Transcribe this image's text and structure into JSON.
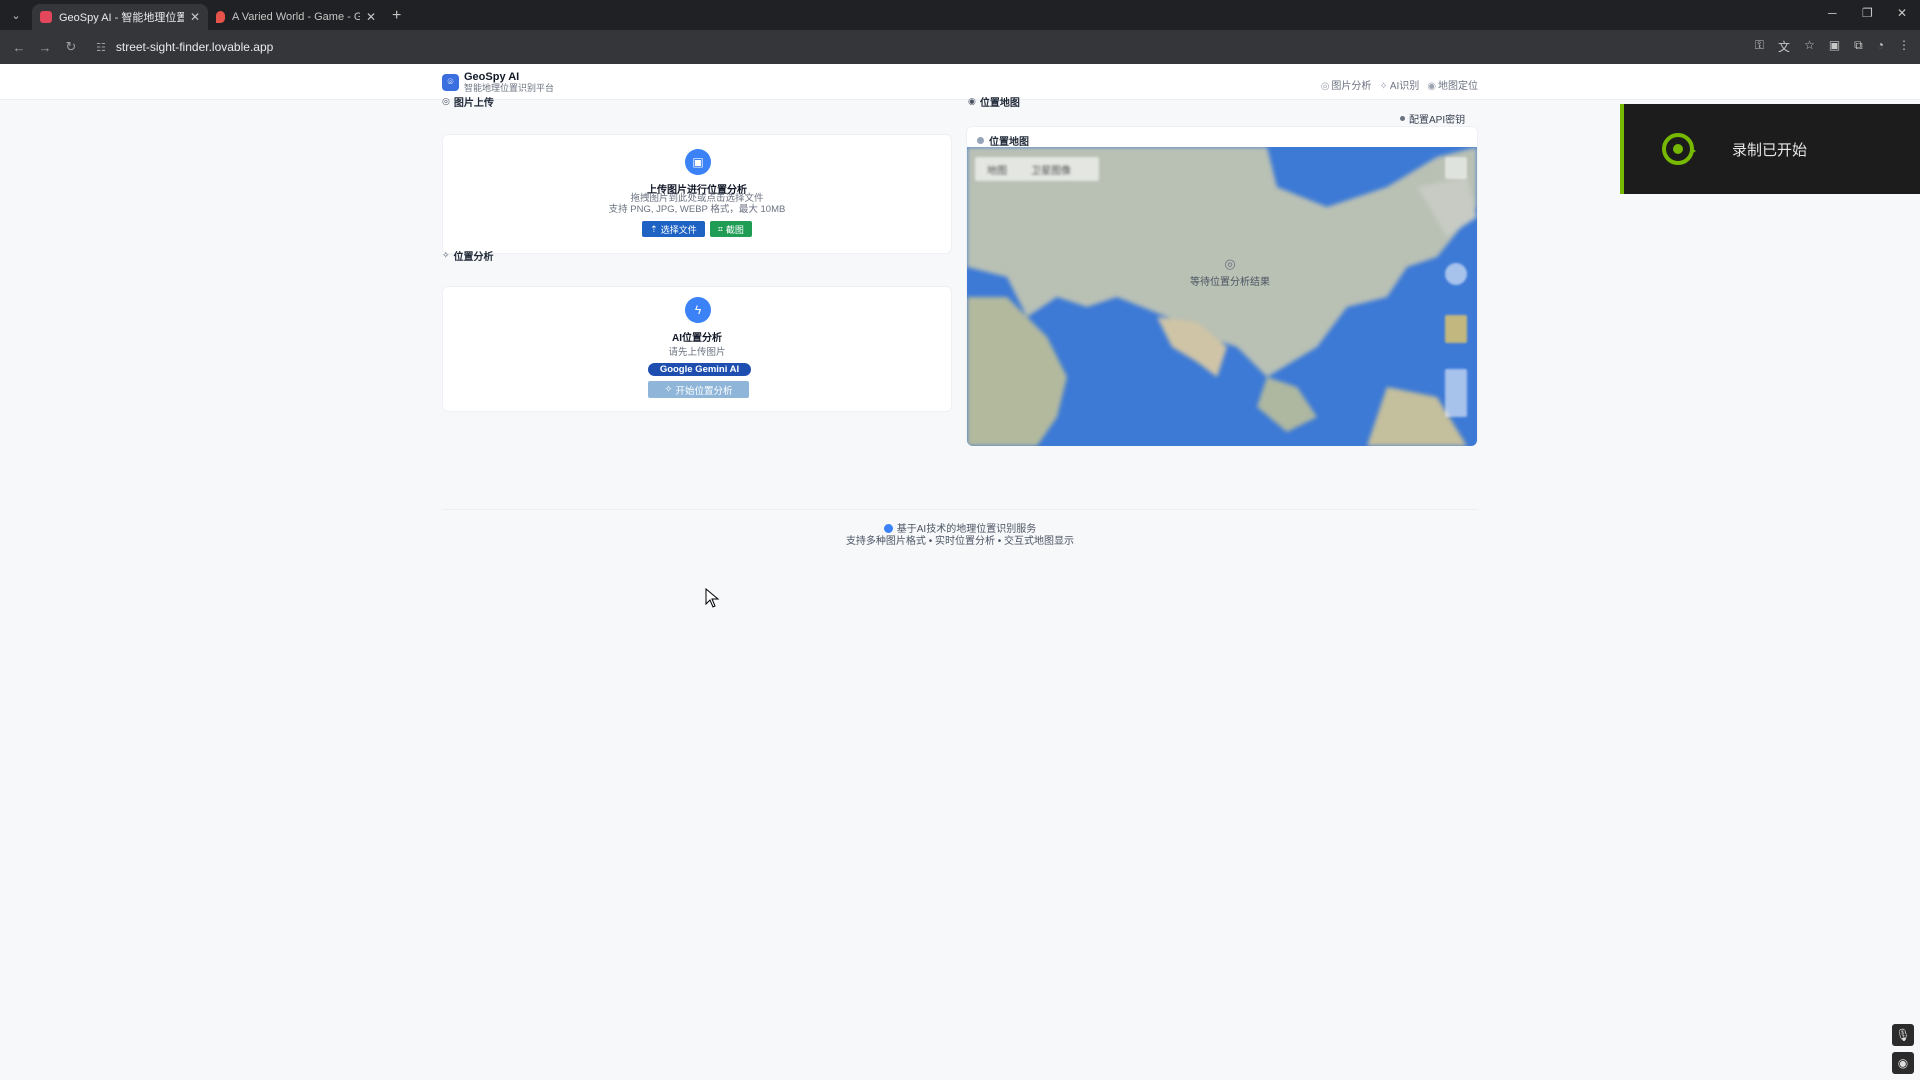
{
  "browser": {
    "tabs": [
      {
        "title": "GeoSpy AI - 智能地理位置识别",
        "active": true
      },
      {
        "title": "A Varied World - Game - Geo",
        "active": false
      }
    ],
    "url": "street-sight-finder.lovable.app"
  },
  "header": {
    "brand_name": "GeoSpy AI",
    "brand_subtitle": "智能地理位置识别平台",
    "nav": [
      "图片分析",
      "AI识别",
      "地图定位"
    ]
  },
  "upload": {
    "section_title": "图片上传",
    "heading": "上传图片进行位置分析",
    "hint_line1": "拖拽图片到此处或点击选择文件",
    "hint_line2": "支持 PNG, JPG, WEBP 格式，最大 10MB",
    "choose_file_label": "选择文件",
    "screenshot_label": "截图"
  },
  "analysis": {
    "section_title": "位置分析",
    "heading": "AI位置分析",
    "hint": "请先上传图片",
    "badge": "Google Gemini AI",
    "start_button": "开始位置分析"
  },
  "map": {
    "section_title": "位置地图",
    "api_key_label": "配置API密钥",
    "card_title": "位置地图",
    "map_type_tabs": [
      "地图",
      "卫星图像"
    ],
    "pin_label": "等待位置分析结果"
  },
  "footer": {
    "line1": "基于AI技术的地理位置识别服务",
    "line2": "支持多种图片格式 • 实时位置分析 • 交互式地图显示"
  },
  "recording_toast": {
    "text": "录制已开始"
  },
  "colors": {
    "primary": "#3b82f6",
    "button_blue": "#1e63c4",
    "button_green": "#1f9d55",
    "map_water": "#3d7ad6",
    "toast_accent": "#76b900"
  }
}
